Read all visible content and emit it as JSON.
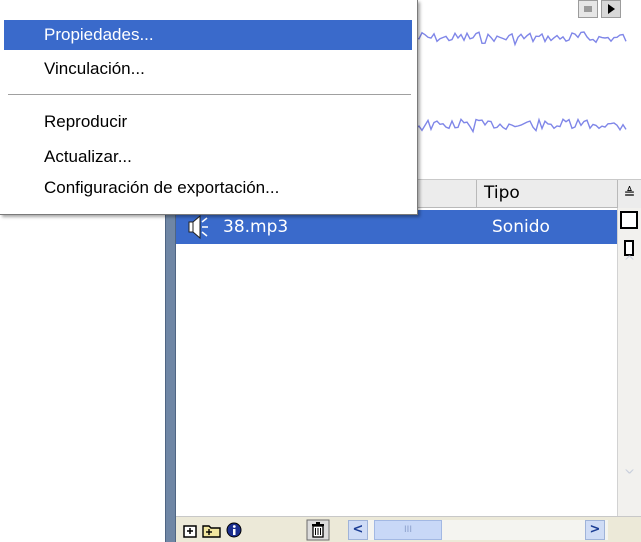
{
  "context_menu": {
    "items": [
      {
        "label": "Propiedades..."
      },
      {
        "label": "Vinculación..."
      },
      {
        "label": "Reproducir"
      },
      {
        "label": "Actualizar..."
      },
      {
        "label": "Configuración de exportación..."
      }
    ],
    "highlighted_index": 0
  },
  "library": {
    "columns": {
      "type_header": "Tipo",
      "sort_toggle": "≜"
    },
    "rows": [
      {
        "name": "38.mp3",
        "type": "Sonido",
        "icon": "speaker-icon",
        "selected": true
      }
    ],
    "scroll": {
      "left": "<",
      "right": ">",
      "thumb": "III",
      "up": "^"
    }
  },
  "colors": {
    "selection": "#3a6acb",
    "waveform": "#7f86e8",
    "panel_strip": "#6f86a5"
  }
}
